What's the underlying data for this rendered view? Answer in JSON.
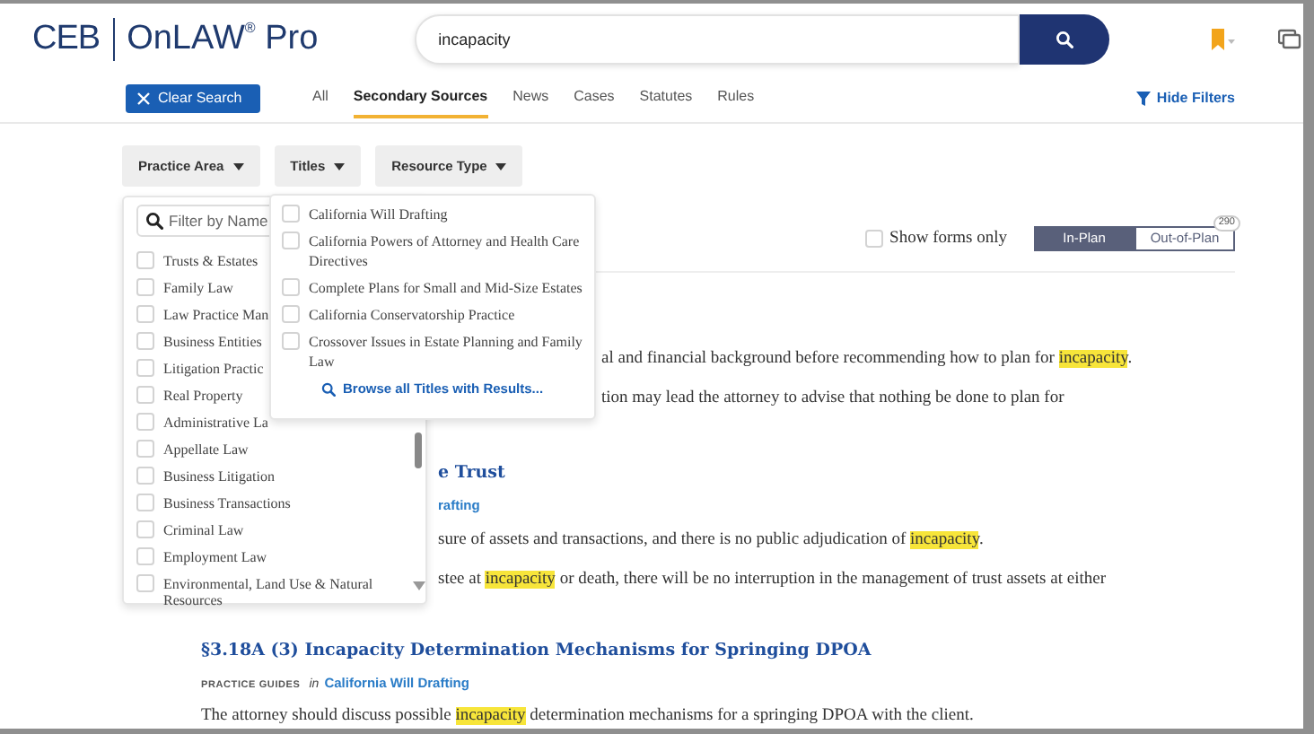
{
  "header": {
    "logo": "CEB",
    "product": "OnLAW$^{®}$ Pro"
  },
  "search": {
    "value": "incapacity"
  },
  "clear_button": "Clear Search",
  "tabs": [
    {
      "label": "All",
      "selected": false
    },
    {
      "label": "Secondary Sources",
      "selected": true
    },
    {
      "label": "News",
      "selected": false
    },
    {
      "label": "Cases",
      "selected": false
    },
    {
      "label": "Statutes",
      "selected": false
    },
    {
      "label": "Rules",
      "selected": false
    }
  ],
  "hide_filters": "Hide Filters",
  "filters": [
    "Practice Area",
    "Titles",
    "Resource Type"
  ],
  "practice_panel": {
    "placeholder": "Filter by Name",
    "items": [
      {
        "label": "Trusts & Estates",
        "checked": false
      },
      {
        "label": "Family Law",
        "checked": false
      },
      {
        "label": "Law Practice Man",
        "checked": false
      },
      {
        "label": "Business Entities",
        "checked": false
      },
      {
        "label": "Litigation Practic",
        "checked": false
      },
      {
        "label": "Real Property",
        "checked": false
      },
      {
        "label": "Administrative La",
        "checked": false
      },
      {
        "label": "Appellate Law",
        "checked": false
      },
      {
        "label": "Business Litigation",
        "checked": false
      },
      {
        "label": "Business Transactions",
        "checked": false
      },
      {
        "label": "Criminal Law",
        "checked": false
      },
      {
        "label": "Employment Law",
        "checked": false
      },
      {
        "label": "Environmental, Land Use & Natural Resources",
        "checked": false
      }
    ]
  },
  "titles_panel": {
    "items": [
      {
        "label": "California Will Drafting",
        "checked": false
      },
      {
        "label": "California Powers of Attorney and Health Care Directives",
        "checked": false
      },
      {
        "label": "Complete Plans for Small and Mid-Size Estates",
        "checked": false
      },
      {
        "label": "California Conservatorship Practice",
        "checked": false
      },
      {
        "label": "Crossover Issues in Estate Planning and Family Law",
        "checked": false
      }
    ],
    "browse": "Browse all Titles with Results..."
  },
  "forms_only": {
    "label": "Show forms only",
    "checked": false
  },
  "plan_toggle": [
    {
      "label": "In-Plan",
      "selected": true
    },
    {
      "label": "Out-of-Plan",
      "selected": false
    }
  ],
  "plan_count": "290",
  "results": [
    {
      "lines": [
        {
          "kind": "snippet",
          "parts": [
            {
              "text": "al and financial background before recommending how to plan for ",
              "highlight": false
            },
            {
              "text": "incapacity",
              "highlight": true
            },
            {
              "text": ".",
              "highlight": false
            }
          ]
        },
        {
          "kind": "snippet",
          "parts": [
            {
              "text": "tion may lead the attorney to advise that nothing be done to plan for",
              "highlight": false
            }
          ]
        }
      ]
    },
    {
      "lines": [
        {
          "kind": "title",
          "text": "e Trust"
        },
        {
          "kind": "meta",
          "link": "rafting"
        },
        {
          "kind": "snippet",
          "parts": [
            {
              "text": "sure of assets and transactions, and there is no public adjudication of ",
              "highlight": false
            },
            {
              "text": "incapacity",
              "highlight": true
            },
            {
              "text": ".",
              "highlight": false
            }
          ]
        },
        {
          "kind": "snippet",
          "parts": [
            {
              "text": "stee at ",
              "highlight": false
            },
            {
              "text": "incapacity",
              "highlight": true
            },
            {
              "text": " or death, there will be no interruption in the management of trust assets at either",
              "highlight": false
            }
          ]
        }
      ]
    },
    {
      "lines": [
        {
          "kind": "title",
          "text": "§3.18A (3) Incapacity Determination Mechanisms for Springing DPOA"
        },
        {
          "kind": "meta",
          "label": "PRACTICE GUIDES",
          "in": "in",
          "link": "California Will Drafting"
        },
        {
          "kind": "snippet",
          "parts": [
            {
              "text": "The attorney should discuss possible ",
              "highlight": false
            },
            {
              "text": "incapacity",
              "highlight": true
            },
            {
              "text": " determination mechanisms for a springing DPOA with the client.",
              "highlight": false
            }
          ]
        }
      ]
    }
  ]
}
